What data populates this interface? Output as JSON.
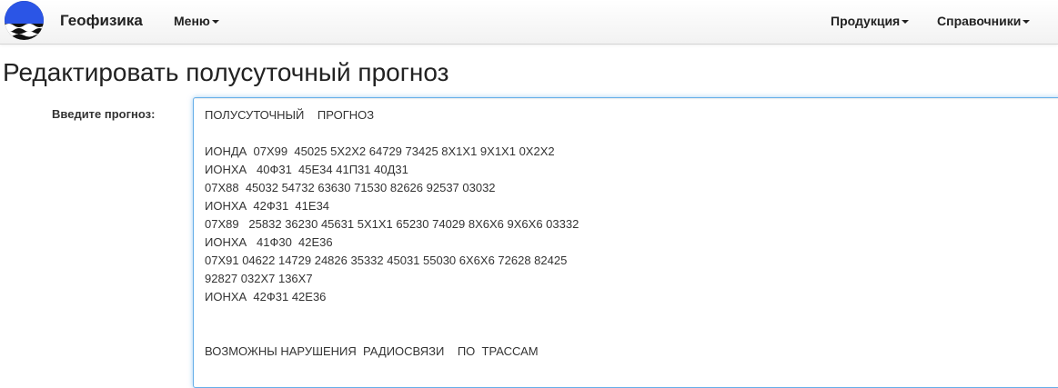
{
  "navbar": {
    "brand": "Геофизика",
    "menu_label": "Меню",
    "products_label": "Продукция",
    "references_label": "Справочники"
  },
  "page": {
    "title": "Редактировать полусуточный прогноз"
  },
  "form": {
    "label": "Введите прогноз:",
    "forecast_value": "ПОЛУСУТОЧНЫЙ    ПРОГНОЗ\n\nИОНДА  07Х99  45025 5Х2Х2 64729 73425 8Х1Х1 9Х1Х1 0Х2Х2\nИОНХА   40Ф31  45Е34 41П31 40Д31\n07Х88  45032 54732 63630 71530 82626 92537 03032\nИОНХА  42Ф31  41Е34\n07Х89   25832 36230 45631 5Х1Х1 65230 74029 8Х6Х6 9Х6Х6 03332\nИОНХА   41Ф30  42Е36\n07Х91 04622 14729 24826 35332 45031 55030 6Х6Х6 72628 82425\n92827 032Х7 136Х7\nИОНХА  42Ф31 42Е36\n\n\nВОЗМОЖНЫ НАРУШЕНИЯ  РАДИОСВЯЗИ    ПО  ТРАССАМ"
  },
  "colors": {
    "logo_blue": "#2b55e6",
    "logo_dark": "#111111",
    "focus_border": "#66afe9"
  },
  "icons": {
    "logo": "wave-globe-logo",
    "dropdown": "caret-down-icon"
  }
}
